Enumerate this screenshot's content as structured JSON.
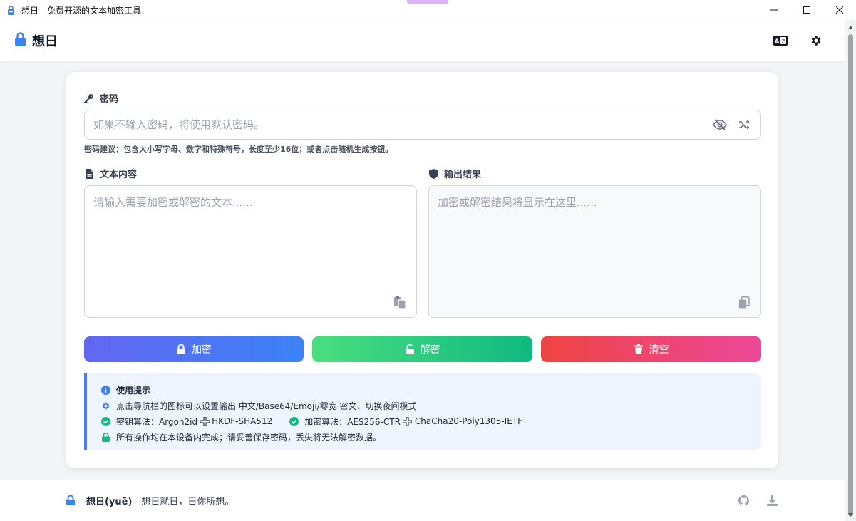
{
  "window": {
    "title": "想日 - 免费开源的文本加密工具",
    "minimize": "minimize",
    "maximize": "maximize",
    "close": "close"
  },
  "header": {
    "brand": "想日",
    "icons": [
      "translate-icon",
      "gear-icon"
    ]
  },
  "password": {
    "label": "密码",
    "placeholder": "如果不输入密码，将使用默认密码。",
    "value": "",
    "hint": "密码建议：包含大小写字母、数字和特殊符号，长度至少16位；或者点击随机生成按钮。"
  },
  "input_text": {
    "label": "文本内容",
    "placeholder": "请输入需要加密或解密的文本......",
    "value": ""
  },
  "output_text": {
    "label": "输出结果",
    "placeholder": "加密或解密结果将显示在这里......",
    "value": ""
  },
  "buttons": {
    "encrypt": "加密",
    "decrypt": "解密",
    "clear": "清空"
  },
  "tips": {
    "title": "使用提示",
    "nav_tip": "点击导航栏的图标可以设置输出 中文/Base64/Emoji/零宽 密文、切换夜间模式",
    "key_algo_label": "密钥算法：Argon2id",
    "key_algo_2": "HKDF-SHA512",
    "enc_algo_label": "加密算法：AES256-CTR",
    "enc_algo_2": "ChaCha20-Poly1305-IETF",
    "local_tip": "所有操作均在本设备内完成；请妥善保存密码，丢失将无法解密数据。"
  },
  "footer": {
    "name": "想日(yuē)",
    "slogan": "- 想日就日，日你所想。"
  },
  "colors": {
    "accent": "#3b82f6",
    "encrypt_from": "#6366f1",
    "encrypt_to": "#3b82f6",
    "decrypt_from": "#4ade80",
    "decrypt_to": "#10b981",
    "clear_from": "#ef4444",
    "clear_to": "#ec4899",
    "tips_bg": "#eef5ff",
    "success": "#10b981"
  }
}
